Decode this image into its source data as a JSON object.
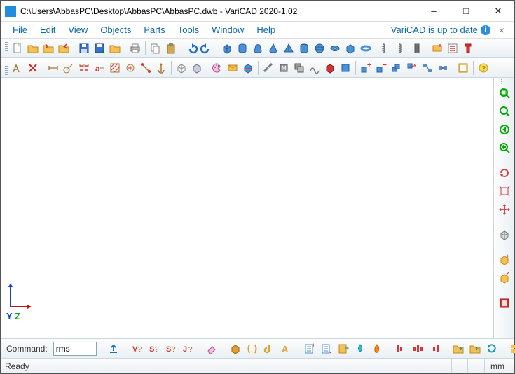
{
  "title": "C:\\Users\\AbbasPC\\Desktop\\AbbasPC\\AbbasPC.dwb - VariCAD 2020-1.02",
  "menu": {
    "file": "File",
    "edit": "Edit",
    "view": "View",
    "objects": "Objects",
    "parts": "Parts",
    "tools": "Tools",
    "window": "Window",
    "help": "Help"
  },
  "update_status": "VariCAD is up to date",
  "axes": {
    "y": "Y",
    "z": "Z"
  },
  "command": {
    "label": "Command:",
    "value": "rms"
  },
  "status": {
    "ready": "Ready",
    "units": "mm"
  }
}
